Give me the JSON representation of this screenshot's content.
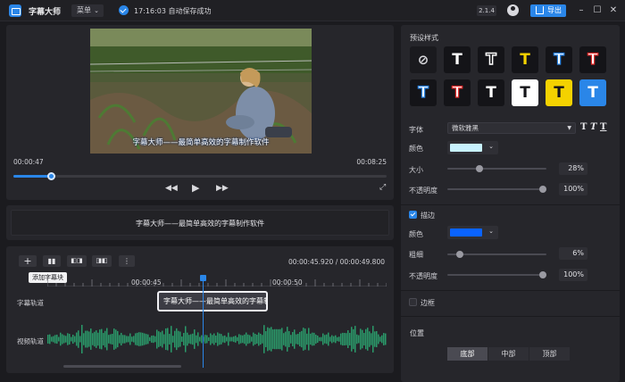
{
  "app": {
    "title": "字幕大师",
    "menu_label": "菜单",
    "save_status": "17:16:03 自动保存成功",
    "version": "2.1.4",
    "export_label": "导出"
  },
  "colors": {
    "accent": "#2a86e8",
    "subtitle_fill": "#c8f2ff",
    "stroke_color": "#0a63ff"
  },
  "player": {
    "subtitle_overlay": "字幕大师——最简单高效的字幕制作软件",
    "current_time": "00:00:47",
    "total_time": "00:08:25",
    "progress": 0.1
  },
  "subtitle_editor": {
    "text": "字幕大师——最简单高效的字幕制作软件"
  },
  "timeline": {
    "add_tooltip": "添加字幕块",
    "time_display": "00:00:45.920  /  00:00:49.800",
    "ruler_labels": [
      "00:00:45",
      "00:00:50"
    ],
    "tracks": {
      "subtitle": "字幕轨道",
      "video": "视频轨道"
    },
    "subtitle_block_text": "字幕大师——最简单高效的字幕制作软件"
  },
  "style_panel": {
    "preset_title": "预设样式",
    "font_label": "字体",
    "font_value": "微软雅黑",
    "color_label": "颜色",
    "size_label": "大小",
    "size_value": "28%",
    "size_level": 0.31,
    "opacity_label": "不透明度",
    "opacity_value": "100%",
    "opacity_level": 1.0,
    "stroke_label": "描边",
    "stroke_checked": true,
    "stroke_color_label": "颜色",
    "thickness_label": "粗细",
    "thickness_value": "6%",
    "thickness_level": 0.1,
    "stroke_opacity_label": "不透明度",
    "stroke_opacity_value": "100%",
    "stroke_opacity_level": 1.0,
    "border_label": "边框",
    "border_checked": false,
    "position_title": "位置",
    "position_options": [
      "底部",
      "中部",
      "顶部"
    ],
    "position_selected": "底部"
  }
}
